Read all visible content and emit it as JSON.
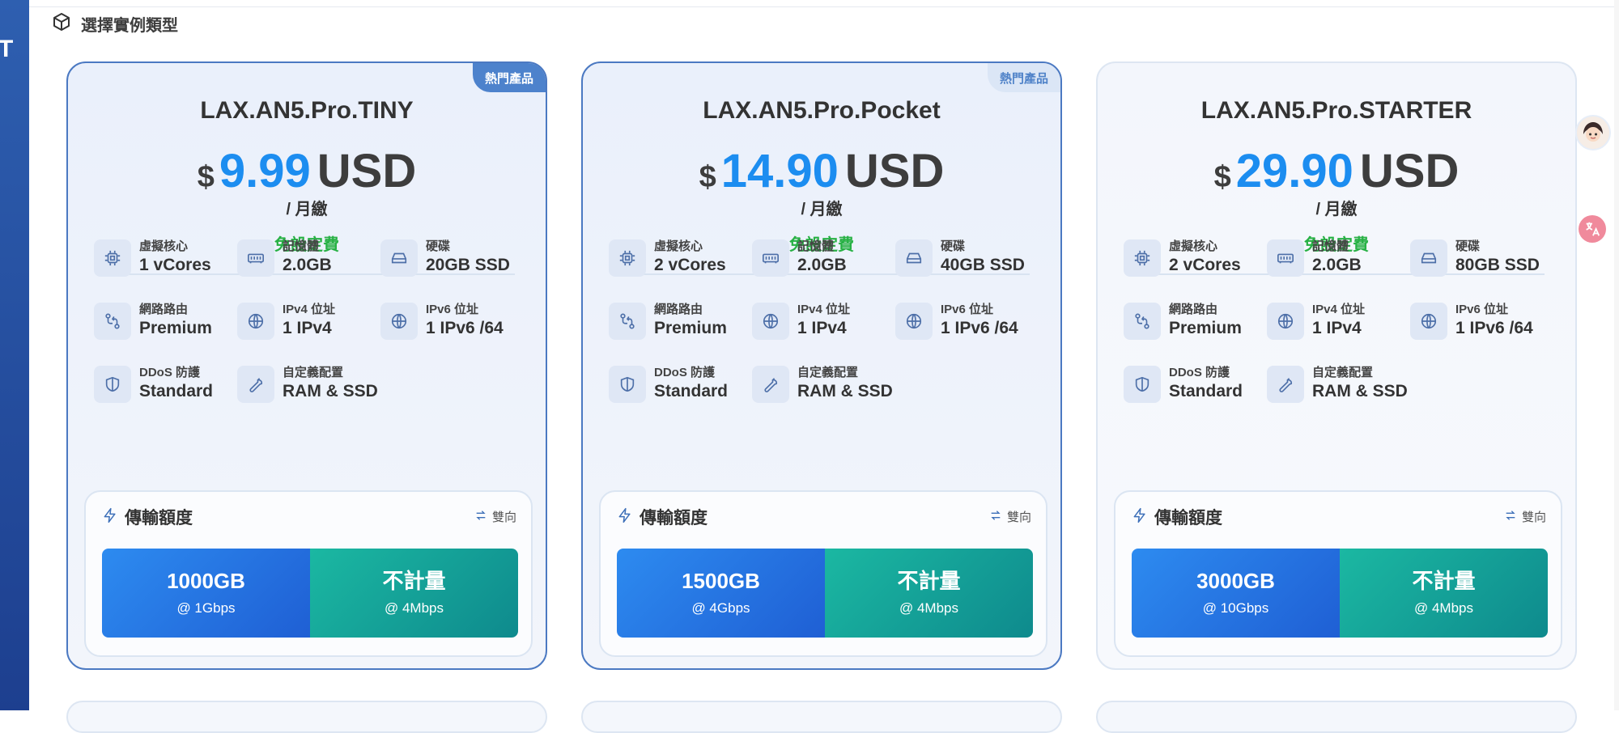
{
  "section": {
    "title": "選擇實例類型"
  },
  "left_fragment": "T",
  "plans": [
    {
      "badge": "熱門產品",
      "name": "LAX.AN5.Pro.TINY",
      "currency_symbol": "$",
      "price": "9.99",
      "currency": "USD",
      "period": "/ 月繳",
      "setup": "免設定費",
      "specs": {
        "cpu": {
          "label": "虛擬核心",
          "value": "1 vCores"
        },
        "ram": {
          "label": "記憶體",
          "value": "2.0GB"
        },
        "disk": {
          "label": "硬碟",
          "value": "20GB SSD"
        },
        "route": {
          "label": "網路路由",
          "value": "Premium"
        },
        "ipv4": {
          "label": "IPv4 位址",
          "value": "1 IPv4"
        },
        "ipv6": {
          "label": "IPv6 位址",
          "value": "1 IPv6 /64"
        },
        "ddos": {
          "label": "DDoS 防護",
          "value": "Standard"
        },
        "custom": {
          "label": "自定義配置",
          "value": "RAM & SSD"
        }
      },
      "bandwidth": {
        "title": "傳輸額度",
        "direction": "雙向",
        "primary": {
          "amount": "1000GB",
          "speed": "@ 1Gbps"
        },
        "overage": {
          "amount": "不計量",
          "speed": "@ 4Mbps"
        }
      }
    },
    {
      "badge": "熱門產品",
      "name": "LAX.AN5.Pro.Pocket",
      "currency_symbol": "$",
      "price": "14.90",
      "currency": "USD",
      "period": "/ 月繳",
      "setup": "免設定費",
      "specs": {
        "cpu": {
          "label": "虛擬核心",
          "value": "2 vCores"
        },
        "ram": {
          "label": "記憶體",
          "value": "2.0GB"
        },
        "disk": {
          "label": "硬碟",
          "value": "40GB SSD"
        },
        "route": {
          "label": "網路路由",
          "value": "Premium"
        },
        "ipv4": {
          "label": "IPv4 位址",
          "value": "1 IPv4"
        },
        "ipv6": {
          "label": "IPv6 位址",
          "value": "1 IPv6 /64"
        },
        "ddos": {
          "label": "DDoS 防護",
          "value": "Standard"
        },
        "custom": {
          "label": "自定義配置",
          "value": "RAM & SSD"
        }
      },
      "bandwidth": {
        "title": "傳輸額度",
        "direction": "雙向",
        "primary": {
          "amount": "1500GB",
          "speed": "@ 4Gbps"
        },
        "overage": {
          "amount": "不計量",
          "speed": "@ 4Mbps"
        }
      }
    },
    {
      "badge": "",
      "name": "LAX.AN5.Pro.STARTER",
      "currency_symbol": "$",
      "price": "29.90",
      "currency": "USD",
      "period": "/ 月繳",
      "setup": "免設定費",
      "specs": {
        "cpu": {
          "label": "虛擬核心",
          "value": "2 vCores"
        },
        "ram": {
          "label": "記憶體",
          "value": "2.0GB"
        },
        "disk": {
          "label": "硬碟",
          "value": "80GB SSD"
        },
        "route": {
          "label": "網路路由",
          "value": "Premium"
        },
        "ipv4": {
          "label": "IPv4 位址",
          "value": "1 IPv4"
        },
        "ipv6": {
          "label": "IPv6 位址",
          "value": "1 IPv6 /64"
        },
        "ddos": {
          "label": "DDoS 防護",
          "value": "Standard"
        },
        "custom": {
          "label": "自定義配置",
          "value": "RAM & SSD"
        }
      },
      "bandwidth": {
        "title": "傳輸額度",
        "direction": "雙向",
        "primary": {
          "amount": "3000GB",
          "speed": "@ 10Gbps"
        },
        "overage": {
          "amount": "不計量",
          "speed": "@ 4Mbps"
        }
      }
    }
  ],
  "colors": {
    "price_accent": "#1c8df0",
    "setup_green": "#27b144",
    "selected_border": "#4b79c2",
    "tile_blue": "#2d8bf0",
    "tile_teal": "#1bb8a2"
  },
  "icons": {
    "section": "cube-icon",
    "cpu": "cpu-chip-icon",
    "ram": "memory-icon",
    "disk": "hard-drive-icon",
    "route": "route-icon",
    "ipv4": "globe-icon",
    "ipv6": "globe-icon",
    "ddos": "shield-icon",
    "custom": "wrench-icon",
    "bandwidth": "lightning-icon",
    "direction": "swap-arrows-icon"
  }
}
